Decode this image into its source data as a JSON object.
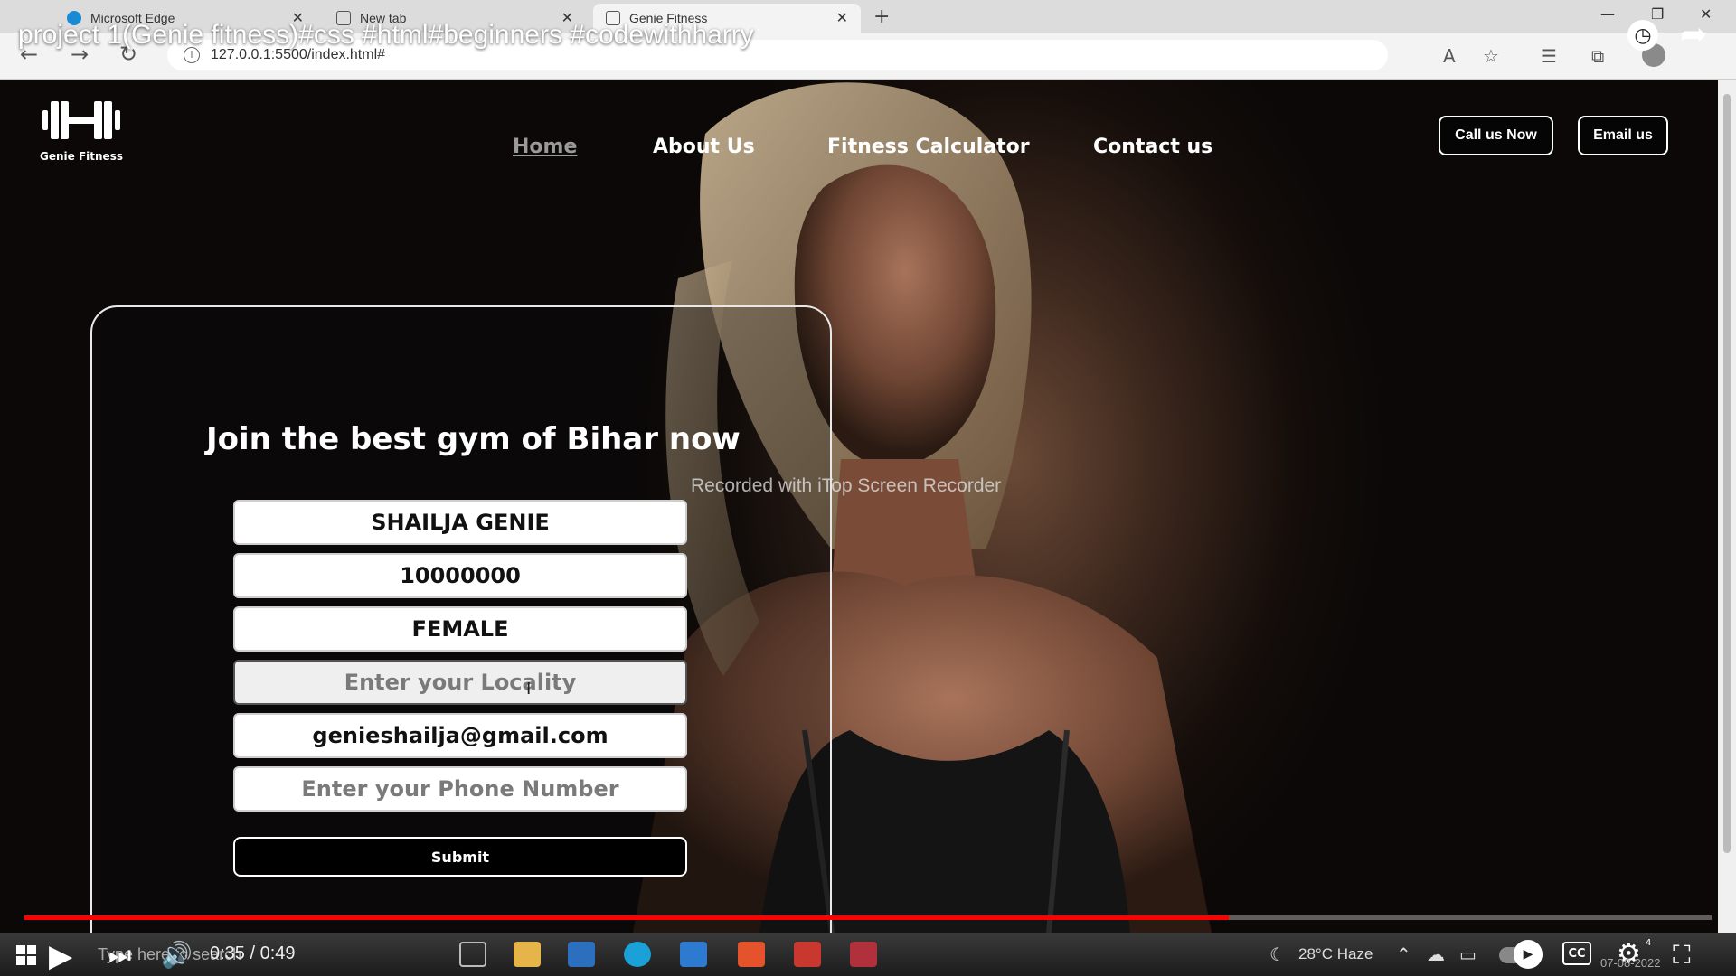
{
  "browser": {
    "tabs": [
      {
        "label": "Microsoft Edge"
      },
      {
        "label": "New tab"
      },
      {
        "label": "Genie Fitness"
      }
    ],
    "url": "127.0.0.1:5500/index.html#"
  },
  "video": {
    "title": "project 1(Genie fitness)#css #html#beginners #codewithharry",
    "time": "0:35 / 0:49",
    "progress": 0.714,
    "search_hint": "Type here to search",
    "weather": "28°C  Haze",
    "date": "07-08-2022",
    "settings_badge": "4",
    "cc_label": "CC"
  },
  "site": {
    "logo_text": "Genie Fitness",
    "nav": [
      {
        "label": "Home",
        "active": true
      },
      {
        "label": "About Us"
      },
      {
        "label": "Fitness Calculator"
      },
      {
        "label": "Contact us"
      }
    ],
    "call_button": "Call us Now",
    "email_button": "Email us"
  },
  "form": {
    "heading": "Join the best gym of Bihar now",
    "fields": [
      {
        "value": "SHAILJA GENIE",
        "placeholder": ""
      },
      {
        "value": "10000000",
        "placeholder": ""
      },
      {
        "value": "FEMALE",
        "placeholder": ""
      },
      {
        "value": "",
        "placeholder": "Enter your Locality"
      },
      {
        "value": "genieshailja@gmail.com",
        "placeholder": ""
      },
      {
        "value": "",
        "placeholder": "Enter your Phone Number"
      }
    ],
    "submit_label": "Submit"
  },
  "overlay": {
    "watermark": "Recorded with iTop Screen Recorder"
  },
  "colors": {
    "progress": "#ff0000",
    "page_background": "#0b0807",
    "card_border": "#e8e8e8"
  }
}
